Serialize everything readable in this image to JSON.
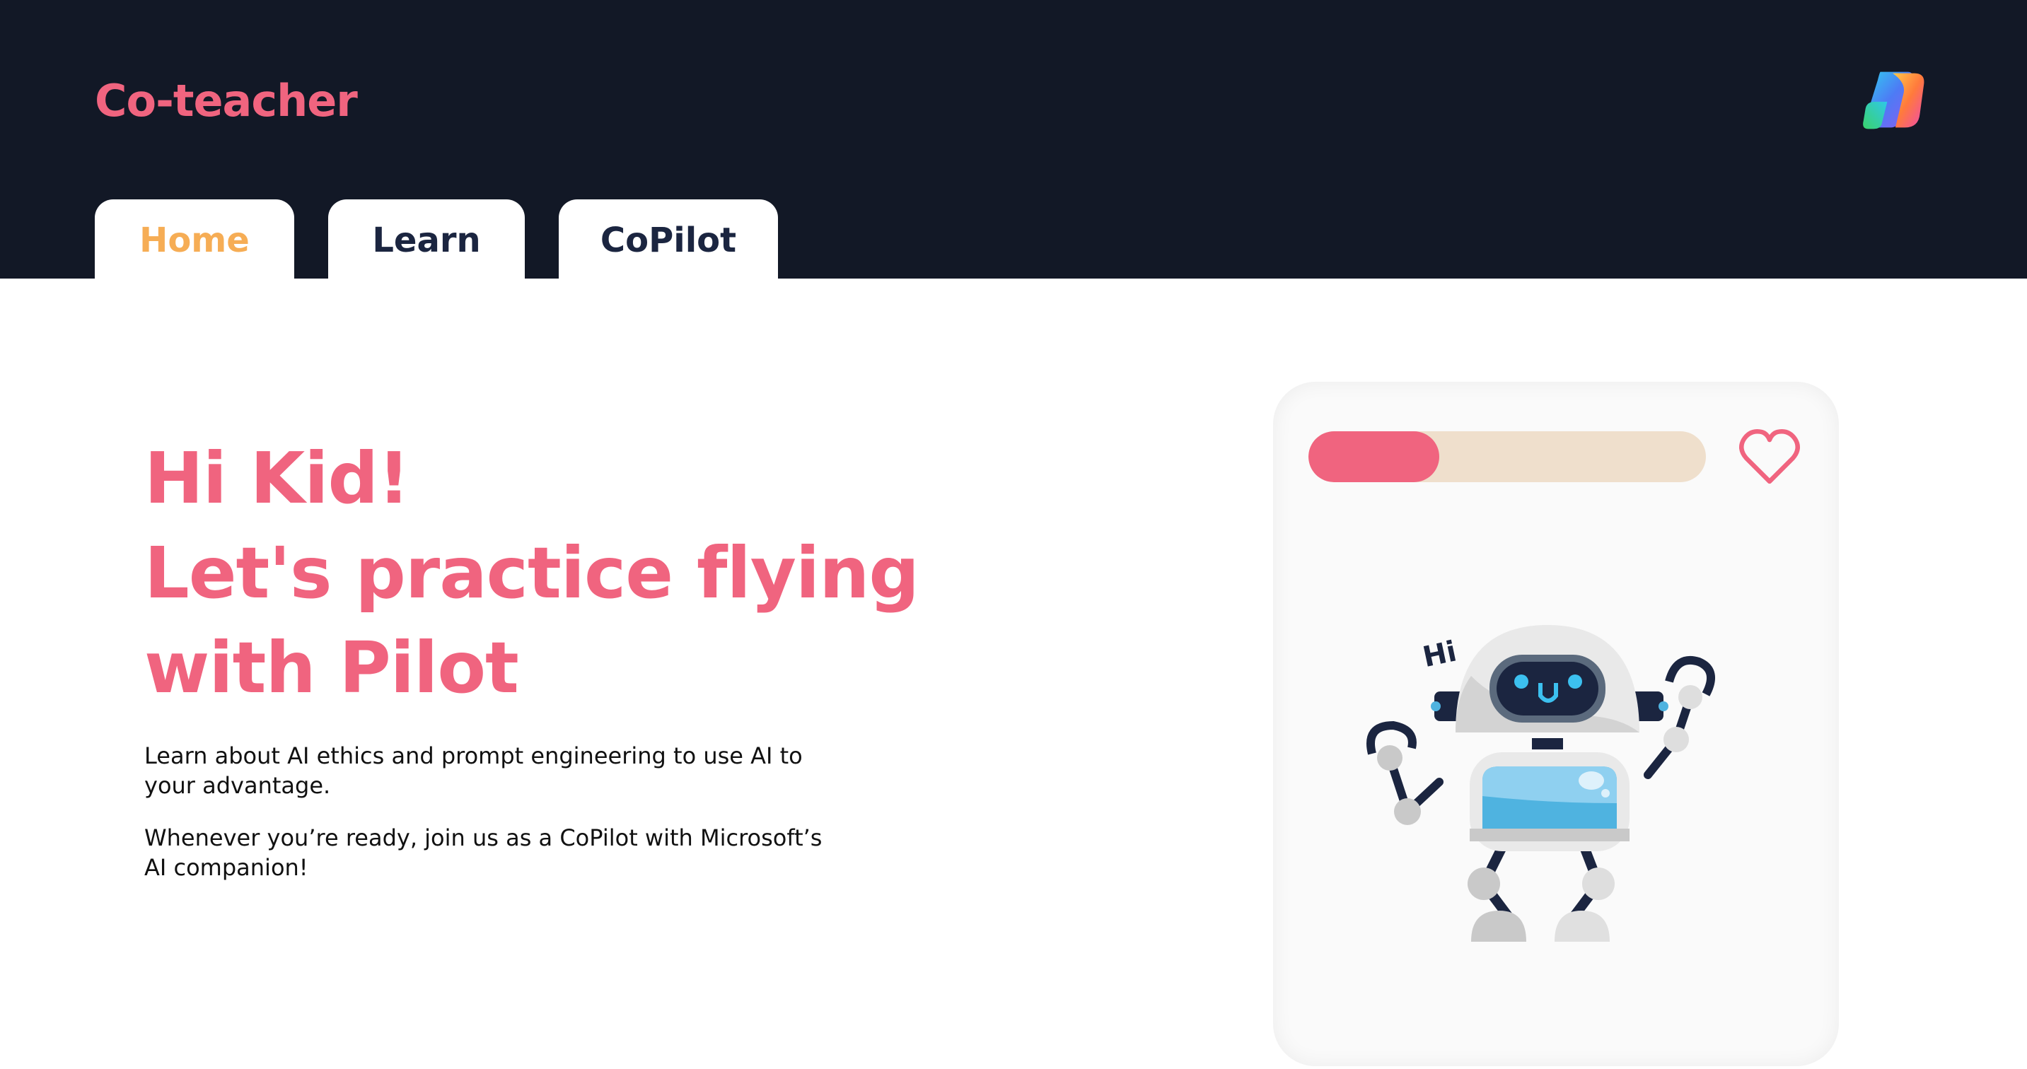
{
  "app": {
    "brand": "Co-teacher",
    "logo_icon": "copilot-logo-icon"
  },
  "nav": {
    "tabs": [
      {
        "label": "Home",
        "active": true
      },
      {
        "label": "Learn",
        "active": false
      },
      {
        "label": "CoPilot",
        "active": false
      }
    ]
  },
  "hero": {
    "title_lines": [
      "Hi Kid!",
      "Let's practice flying",
      "with Pilot"
    ],
    "paragraph1": "Learn about AI ethics and prompt engineering to use AI to your advantage.",
    "paragraph2": "Whenever you’re ready, join us as a CoPilot with Microsoft’s AI companion!"
  },
  "card": {
    "progress_fraction": 0.33,
    "favorite_icon": "heart-icon",
    "illustration": "robot-illustration",
    "robot_speech": "Hi"
  },
  "colors": {
    "brand": "#f0647f",
    "active_tab": "#f6ad55",
    "header_bg": "#121826",
    "tab_text": "#1b2540",
    "progress_track": "#efdfcc"
  }
}
